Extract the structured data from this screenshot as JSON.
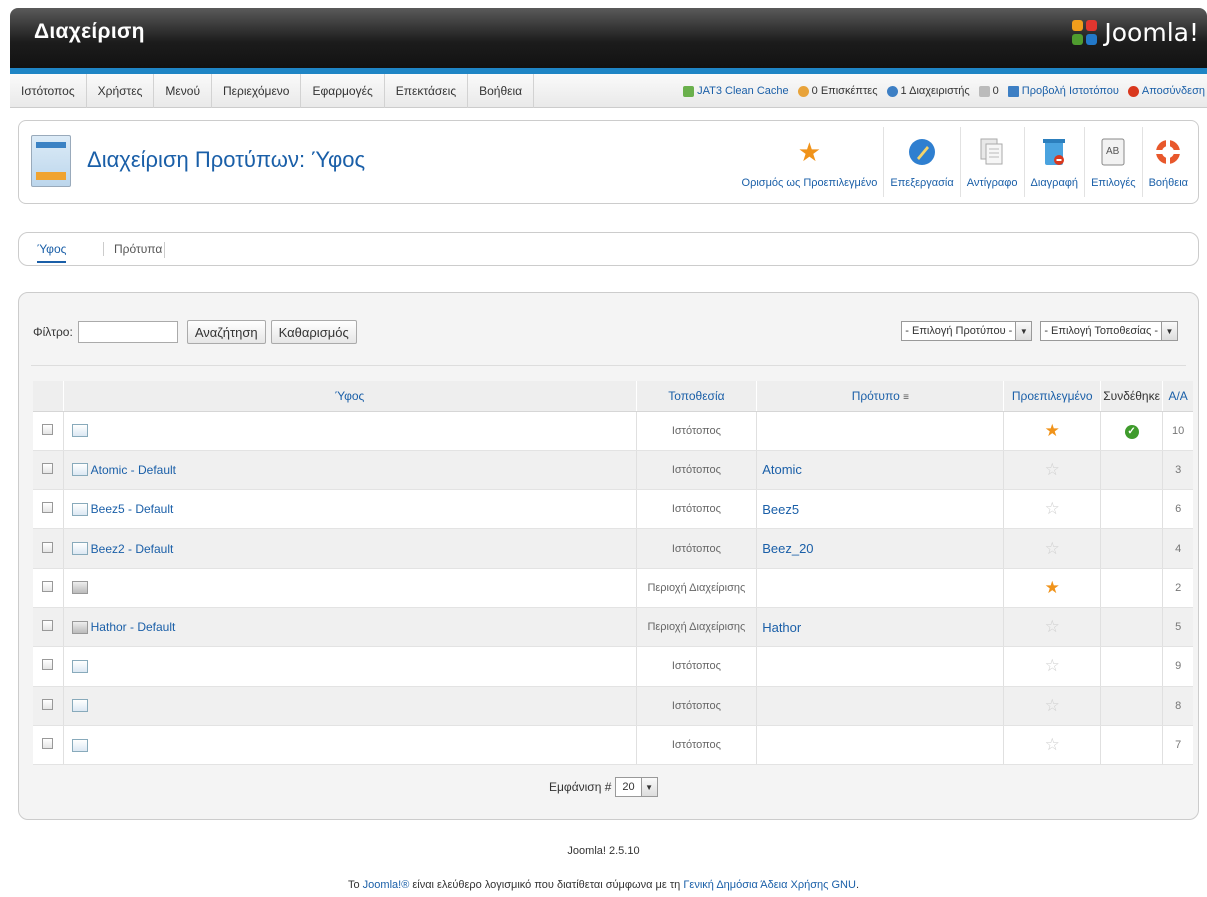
{
  "header": {
    "title": "Διαχείριση",
    "logo_text": "Joomla!"
  },
  "menu": {
    "items": [
      "Ιστότοπος",
      "Χρήστες",
      "Μενού",
      "Περιεχόμενο",
      "Εφαρμογές",
      "Επεκτάσεις",
      "Βοήθεια"
    ]
  },
  "status": {
    "cache": "JAT3 Clean Cache",
    "visitors": "0 Επισκέπτες",
    "admins": "1 Διαχειριστής",
    "messages": "0",
    "preview": "Προβολή Ιστοτόπου",
    "logout": "Αποσύνδεση"
  },
  "toolbar": {
    "page_title": "Διαχείριση Προτύπων: Ύφος",
    "buttons": [
      {
        "label": "Ορισμός ως Προεπιλεγμένο",
        "icon": "star-icon"
      },
      {
        "label": "Επεξεργασία",
        "icon": "edit-icon"
      },
      {
        "label": "Αντίγραφο",
        "icon": "copy-icon"
      },
      {
        "label": "Διαγραφή",
        "icon": "trash-icon"
      },
      {
        "label": "Επιλογές",
        "icon": "options-icon"
      },
      {
        "label": "Βοήθεια",
        "icon": "help-icon"
      }
    ]
  },
  "tabs": {
    "active": "Ύφος",
    "other": "Πρότυπα"
  },
  "filter": {
    "label": "Φίλτρο:",
    "value": "",
    "search": "Αναζήτηση",
    "clear": "Καθαρισμός",
    "select_template": "- Επιλογή Προτύπου -",
    "select_location": "- Επιλογή Τοποθεσίας -"
  },
  "table": {
    "headers": {
      "style": "Ύφος",
      "location": "Τοποθεσία",
      "template": "Πρότυπο",
      "default": "Προεπιλεγμένο",
      "assigned": "Συνδέθηκε",
      "id": "Α/Α"
    },
    "rows": [
      {
        "style": "",
        "location": "Ιστότοπος",
        "template": "",
        "default": true,
        "assigned": true,
        "id": "10",
        "admin": false
      },
      {
        "style": "Atomic - Default",
        "location": "Ιστότοπος",
        "template": "Atomic",
        "default": false,
        "assigned": false,
        "id": "3",
        "admin": false
      },
      {
        "style": "Beez5 - Default",
        "location": "Ιστότοπος",
        "template": "Beez5",
        "default": false,
        "assigned": false,
        "id": "6",
        "admin": false
      },
      {
        "style": "Beez2 - Default",
        "location": "Ιστότοπος",
        "template": "Beez_20",
        "default": false,
        "assigned": false,
        "id": "4",
        "admin": false
      },
      {
        "style": "",
        "location": "Περιοχή Διαχείρισης",
        "template": "",
        "default": true,
        "assigned": false,
        "id": "2",
        "admin": true
      },
      {
        "style": "Hathor - Default",
        "location": "Περιοχή Διαχείρισης",
        "template": "Hathor",
        "default": false,
        "assigned": false,
        "id": "5",
        "admin": true
      },
      {
        "style": "",
        "location": "Ιστότοπος",
        "template": "",
        "default": false,
        "assigned": false,
        "id": "9",
        "admin": false
      },
      {
        "style": "",
        "location": "Ιστότοπος",
        "template": "",
        "default": false,
        "assigned": false,
        "id": "8",
        "admin": false
      },
      {
        "style": "",
        "location": "Ιστότοπος",
        "template": "",
        "default": false,
        "assigned": false,
        "id": "7",
        "admin": false
      }
    ]
  },
  "pager": {
    "label": "Εμφάνιση #",
    "value": "20"
  },
  "footer": {
    "version": "Joomla! 2.5.10",
    "lic_pre": "Το ",
    "lic_link1": "Joomla!®",
    "lic_mid": " είναι ελεύθερο λογισμικό που διατίθεται σύμφωνα με τη ",
    "lic_link2": "Γενική Δημόσια Άδεια Χρήσης GNU",
    "lic_post": "."
  }
}
